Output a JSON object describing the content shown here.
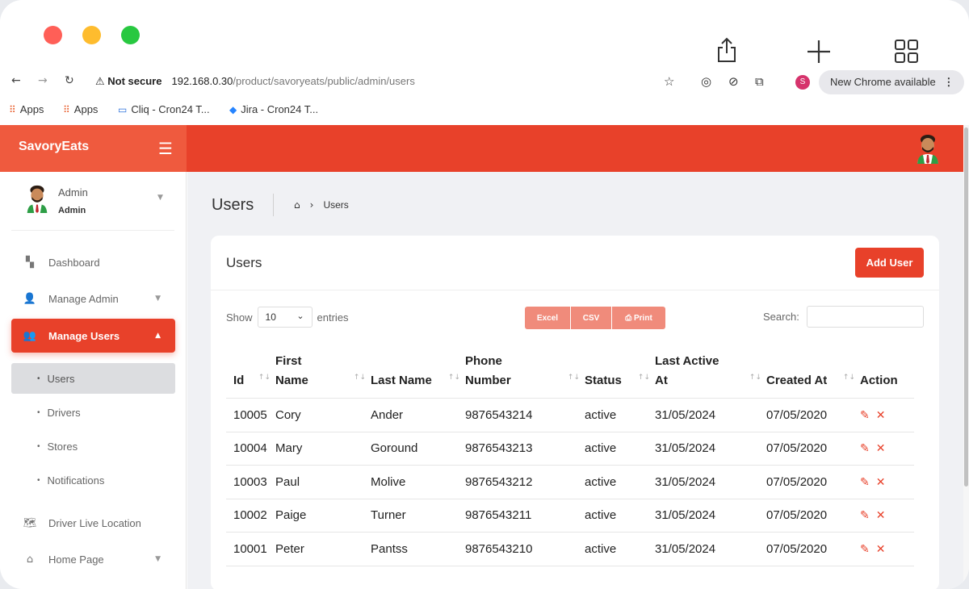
{
  "browser": {
    "not_secure": "Not secure",
    "url_host": "192.168.0.30",
    "url_path": "/product/savoryeats/public/admin/users",
    "chrome_update": "New Chrome available",
    "profile_initial": "S",
    "bookmarks": [
      {
        "label": "Apps",
        "icon": "apps-grid-icon"
      },
      {
        "label": "Apps",
        "icon": "apps-grid-icon"
      },
      {
        "label": "Cliq - Cron24 T...",
        "icon": "cliq-icon"
      },
      {
        "label": "Jira - Cron24 T...",
        "icon": "jira-icon"
      }
    ]
  },
  "app": {
    "brand": "SavoryEats",
    "accent": "#e8412a"
  },
  "sidebar": {
    "user_name": "Admin",
    "user_role": "Admin",
    "menu": [
      {
        "label": "Dashboard",
        "icon": "dashboard-icon"
      },
      {
        "label": "Manage Admin",
        "icon": "admin-icon"
      },
      {
        "label": "Manage Users",
        "icon": "users-icon"
      },
      {
        "label": "Driver Live Location",
        "icon": "map-icon"
      },
      {
        "label": "Home Page",
        "icon": "home-icon"
      }
    ],
    "submenu": [
      {
        "label": "Users"
      },
      {
        "label": "Drivers"
      },
      {
        "label": "Stores"
      },
      {
        "label": "Notifications"
      }
    ]
  },
  "page": {
    "title": "Users",
    "breadcrumb_current": "Users",
    "card_title": "Users",
    "add_button": "Add User",
    "show_label": "Show",
    "entries_value": "10",
    "entries_label": "entries",
    "export": {
      "excel": "Excel",
      "csv": "CSV",
      "print": "Print"
    },
    "search_label": "Search:"
  },
  "table": {
    "headers": {
      "id": "Id",
      "first_name_1": "First",
      "first_name_2": "Name",
      "last_name": "Last Name",
      "phone_1": "Phone",
      "phone_2": "Number",
      "status": "Status",
      "last_active_1": "Last Active",
      "last_active_2": "At",
      "created": "Created At",
      "action": "Action"
    },
    "rows": [
      {
        "id": "10005",
        "first": "Cory",
        "last": "Ander",
        "phone": "9876543214",
        "status": "active",
        "last_active": "31/05/2024",
        "created": "07/05/2020"
      },
      {
        "id": "10004",
        "first": "Mary",
        "last": "Goround",
        "phone": "9876543213",
        "status": "active",
        "last_active": "31/05/2024",
        "created": "07/05/2020"
      },
      {
        "id": "10003",
        "first": "Paul",
        "last": "Molive",
        "phone": "9876543212",
        "status": "active",
        "last_active": "31/05/2024",
        "created": "07/05/2020"
      },
      {
        "id": "10002",
        "first": "Paige",
        "last": "Turner",
        "phone": "9876543211",
        "status": "active",
        "last_active": "31/05/2024",
        "created": "07/05/2020"
      },
      {
        "id": "10001",
        "first": "Peter",
        "last": "Pantss",
        "phone": "9876543210",
        "status": "active",
        "last_active": "31/05/2024",
        "created": "07/05/2020"
      }
    ]
  }
}
